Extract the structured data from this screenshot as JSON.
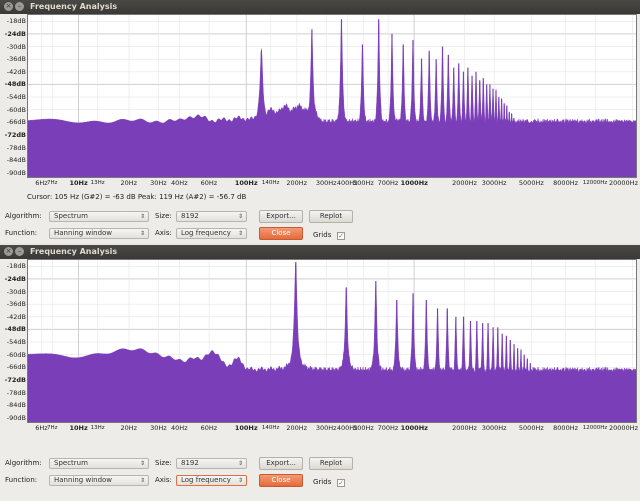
{
  "colors": {
    "spectrum": "#7a3fb8",
    "titlebar": "#3c3b37",
    "close_button": "#e8784a",
    "check": "#d4541b"
  },
  "windows": [
    {
      "title": "Frequency Analysis",
      "cursor_text": "Cursor: 105 Hz (G#2) = -63 dB   Peak: 119 Hz (A#2) = -56.7 dB",
      "y_labels": [
        "-18dB",
        "-24dB",
        "-30dB",
        "-36dB",
        "-42dB",
        "-48dB",
        "-54dB",
        "-60dB",
        "-66dB",
        "-72dB",
        "-78dB",
        "-84dB",
        "-90dB"
      ],
      "x_labels": [
        "6Hz",
        "7Hz",
        "10Hz",
        "13Hz",
        "20Hz",
        "30Hz",
        "40Hz",
        "60Hz",
        "100Hz",
        "140Hz",
        "200Hz",
        "300Hz",
        "400Hz",
        "500Hz",
        "700Hz",
        "1000Hz",
        "2000Hz",
        "3000Hz",
        "5000Hz",
        "8000Hz",
        "12000Hz",
        "20000Hz"
      ],
      "algorithm_label": "Algorithm:",
      "algorithm_value": "Spectrum",
      "size_label": "Size:",
      "size_value": "8192",
      "function_label": "Function:",
      "function_value": "Hanning window",
      "axis_label": "Axis:",
      "axis_value": "Log frequency",
      "export_label": "Export...",
      "replot_label": "Replot",
      "close_label": "Close",
      "grids_label": "Grids",
      "grids_checked": true
    },
    {
      "title": "Frequency Analysis",
      "y_labels": [
        "-18dB",
        "-24dB",
        "-30dB",
        "-36dB",
        "-42dB",
        "-48dB",
        "-54dB",
        "-60dB",
        "-66dB",
        "-72dB",
        "-78dB",
        "-84dB",
        "-90dB"
      ],
      "x_labels": [
        "6Hz",
        "7Hz",
        "10Hz",
        "13Hz",
        "20Hz",
        "30Hz",
        "40Hz",
        "60Hz",
        "100Hz",
        "140Hz",
        "200Hz",
        "300Hz",
        "400Hz",
        "500Hz",
        "700Hz",
        "1000Hz",
        "2000Hz",
        "3000Hz",
        "5000Hz",
        "8000Hz",
        "12000Hz",
        "20000Hz"
      ],
      "algorithm_label": "Algorithm:",
      "algorithm_value": "Spectrum",
      "size_label": "Size:",
      "size_value": "8192",
      "function_label": "Function:",
      "function_value": "Hanning window",
      "axis_label": "Axis:",
      "axis_value": "Log frequency",
      "export_label": "Export...",
      "replot_label": "Replot",
      "close_label": "Close",
      "grids_label": "Grids",
      "grids_checked": true
    }
  ],
  "chart_data": [
    {
      "type": "area",
      "xscale": "log",
      "xlim": [
        5,
        21000
      ],
      "ylim": [
        -92,
        -15
      ],
      "grid": true,
      "fundamental_hz": 123,
      "harmonic_peaks_db": [
        -32,
        -22,
        -17,
        -29,
        -17,
        -24,
        -29,
        -27,
        -36,
        -32,
        -36,
        -30,
        -34,
        -40,
        -38,
        -42,
        -40,
        -44,
        -42,
        -46,
        -45,
        -48,
        -48,
        -50,
        -51,
        -54,
        -55,
        -57,
        -58,
        -61,
        -62,
        -64,
        -66,
        -68,
        -70,
        -72,
        -74,
        -76,
        -78,
        -80,
        -82,
        -84,
        -85,
        -86,
        -87,
        -88,
        -89,
        -90
      ],
      "floor_db": [
        [
          5,
          -66
        ],
        [
          9,
          -71
        ],
        [
          15,
          -73
        ],
        [
          30,
          -73
        ],
        [
          45,
          -68
        ],
        [
          70,
          -67
        ],
        [
          100,
          -66
        ],
        [
          140,
          -65
        ],
        [
          200,
          -65
        ],
        [
          300,
          -67
        ],
        [
          400,
          -69
        ],
        [
          700,
          -70
        ],
        [
          1000,
          -70
        ],
        [
          2000,
          -72
        ],
        [
          3000,
          -75
        ],
        [
          5000,
          -80
        ],
        [
          8000,
          -85
        ],
        [
          12000,
          -91
        ],
        [
          21000,
          -92
        ]
      ],
      "bumps": [
        [
          49,
          -63,
          0.12
        ],
        [
          68,
          -65,
          0.1
        ],
        [
          92,
          -64,
          0.08
        ],
        [
          140,
          -60,
          0.05
        ],
        [
          170,
          -58,
          0.04
        ],
        [
          205,
          -58,
          0.05
        ],
        [
          245,
          -58,
          0.04
        ]
      ]
    },
    {
      "type": "area",
      "xscale": "log",
      "xlim": [
        5,
        21000
      ],
      "ylim": [
        -92,
        -15
      ],
      "grid": true,
      "fundamental_hz": 197,
      "harmonic_peaks_db": [
        -16,
        -28,
        -25,
        -34,
        -31,
        -34,
        -38,
        -38,
        -42,
        -42,
        -44,
        -44,
        -45,
        -45,
        -47,
        -47,
        -50,
        -51,
        -53,
        -55,
        -57,
        -58,
        -60,
        -62,
        -64,
        -66,
        -68,
        -70,
        -72,
        -74,
        -76,
        -78,
        -80,
        -82,
        -84,
        -86,
        -88,
        -89,
        -90,
        -91
      ],
      "floor_db": [
        [
          5,
          -60
        ],
        [
          9,
          -61
        ],
        [
          15,
          -60
        ],
        [
          20,
          -58
        ],
        [
          28,
          -60
        ],
        [
          40,
          -64
        ],
        [
          60,
          -67
        ],
        [
          100,
          -68
        ],
        [
          200,
          -67
        ],
        [
          300,
          -68
        ],
        [
          500,
          -68
        ],
        [
          1000,
          -71
        ],
        [
          2000,
          -75
        ],
        [
          3000,
          -78
        ],
        [
          5000,
          -82
        ],
        [
          8000,
          -86
        ],
        [
          12000,
          -90
        ],
        [
          21000,
          -92
        ]
      ],
      "bumps": [
        [
          20,
          -58,
          0.2
        ],
        [
          48,
          -61,
          0.05
        ],
        [
          63,
          -58,
          0.06
        ],
        [
          88,
          -62,
          0.05
        ]
      ]
    }
  ]
}
